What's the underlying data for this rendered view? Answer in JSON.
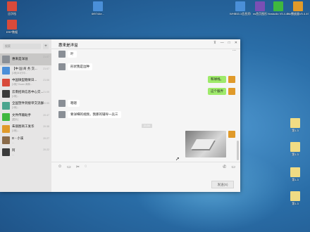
{
  "desktop": {
    "icons": [
      {
        "label": "迅字档",
        "color": "#d83a2a"
      },
      {
        "label": "6f9744e...",
        "color": "#4a7eb5"
      },
      {
        "label": "ERP数据",
        "color": "#c0392b"
      },
      {
        "label": "WHB53.1信息资料2018...",
        "color": "#2e7dbd"
      },
      {
        "label": "ns首页图形",
        "color": "#7a4fb5"
      },
      {
        "label": "Nxstudio V5.4.49.5...",
        "color": "#3b8f5a"
      },
      {
        "label": "Nx播放器V5.4.49.5...",
        "color": "#b5663b"
      },
      {
        "label": "第1.3",
        "color": "#e8d26a"
      },
      {
        "label": "第1.3",
        "color": "#e8d26a"
      },
      {
        "label": "第1.3",
        "color": "#e8d26a"
      },
      {
        "label": "第1.3",
        "color": "#e8d26a"
      }
    ]
  },
  "sidebar": {
    "search_placeholder": "搜索",
    "add_label": "+",
    "conversations": [
      {
        "name": "惠来是洋溢",
        "preview": "",
        "time": "21:07",
        "color": "#8a8f96",
        "active": true
      },
      {
        "name": "【中 国 商 务 交...",
        "preview": "[1条]3D打印...",
        "time": "21:07",
        "color": "#4a8fd8"
      },
      {
        "name": "中国微型糖果日...",
        "preview": "[1条]\"Gsam 两种...",
        "time": "21:06",
        "color": "#d84a3a"
      },
      {
        "name": "云南招商信息中心交...",
        "preview": "[1条]...",
        "time": "21:05",
        "color": "#3b3b3b"
      },
      {
        "name": "全国塑件到接单交流群",
        "preview": "[1条]...",
        "time": "20:55",
        "color": "#4aa58f"
      },
      {
        "name": "文件传输助手",
        "preview": "[图片]",
        "time": "20:47",
        "color": "#3fb83f"
      },
      {
        "name": "朱丽图商工发华",
        "preview": "[1条]...",
        "time": "20:38",
        "color": "#e09a2a"
      },
      {
        "name": "D - 小溪",
        "preview": "...",
        "time": "20:27",
        "color": "#8a6b4a"
      },
      {
        "name": "阿",
        "preview": "...",
        "time": "20:22",
        "color": "#3b3b3b"
      }
    ]
  },
  "chat": {
    "title": "惠来是洋溢",
    "more_icon": "...",
    "messages": [
      {
        "side": "left",
        "text": "叶"
      },
      {
        "side": "left",
        "text": "形状我是边种"
      },
      {
        "side": "right",
        "text": "和球线。"
      },
      {
        "side": "right",
        "text": "这个服弄"
      },
      {
        "side": "left",
        "text": "嗯嗯"
      },
      {
        "side": "left",
        "text": "要详细的视频，我那的辅导一兵三"
      }
    ],
    "timestamp": "21:04",
    "send_label": "发送(S)"
  }
}
